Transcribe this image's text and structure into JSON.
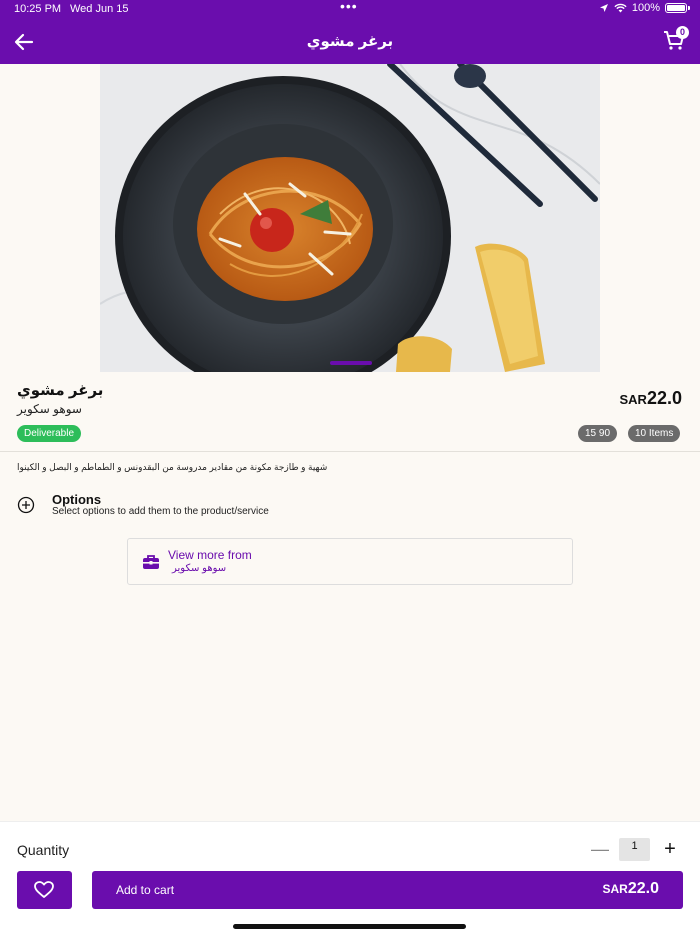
{
  "status": {
    "time": "10:25 PM",
    "date": "Wed Jun 15",
    "dots": "•••",
    "battery": "100%"
  },
  "header": {
    "title": "برغر مشوي",
    "cart_count": "0"
  },
  "product": {
    "name": "برغر مشوي",
    "store": "سوهو سكوير",
    "currency": "SAR",
    "price": "22.0",
    "badge": "Deliverable",
    "tags": [
      "15 90",
      "10 Items"
    ],
    "description": "شهية و طازجة مكونة من مقادير مدروسة من البقدونس و الطماطم و البصل و الكينوا"
  },
  "options": {
    "title": "Options",
    "subtitle": "Select options to add them to the product/service"
  },
  "view_more": {
    "label": "View more from",
    "store": "سوهو سكوير"
  },
  "bottom": {
    "quantity_label": "Quantity",
    "quantity": "1",
    "minus": "—",
    "plus": "+",
    "add_to_cart": "Add to cart",
    "currency": "SAR",
    "price": "22.0"
  },
  "colors": {
    "brand": "#6a0dad",
    "success": "#2dbd5a",
    "tag": "#6b6b6b"
  }
}
